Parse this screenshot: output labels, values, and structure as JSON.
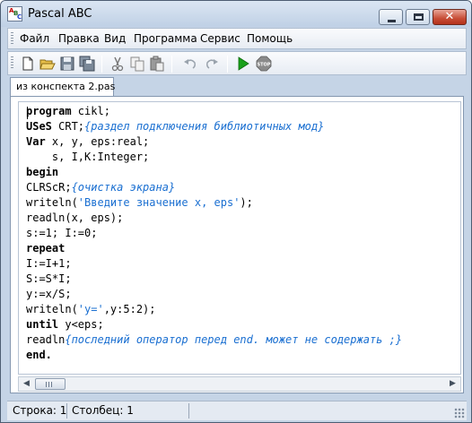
{
  "window": {
    "title": "Pascal ABC",
    "close_label": "✕"
  },
  "menu": {
    "items": [
      "Файл",
      "Правка",
      "Вид",
      "Программа",
      "Сервис",
      "Помощь"
    ]
  },
  "toolbar": {
    "buttons": [
      "new-file-icon",
      "open-folder-icon",
      "save-icon",
      "save-all-icon",
      "cut-icon",
      "copy-icon",
      "paste-icon",
      "undo-icon",
      "redo-icon",
      "run-icon",
      "stop-icon"
    ],
    "stop_label": "STOP",
    "colors": {
      "run": "#1aa01a",
      "stop": "#8a8a8a"
    }
  },
  "tabs": [
    {
      "label": "из конспекта 2.pas",
      "active": true
    }
  ],
  "editor": {
    "lines": [
      [
        {
          "t": "program",
          "k": "kw"
        },
        {
          "t": " cikl;",
          "k": ""
        }
      ],
      [
        {
          "t": "USeS",
          "k": "kw"
        },
        {
          "t": " CRT;",
          "k": ""
        },
        {
          "t": "{раздел подключения библиотичных мод}",
          "k": "cm"
        }
      ],
      [
        {
          "t": "Var",
          "k": "kw"
        },
        {
          "t": " x, y, eps:real;",
          "k": ""
        }
      ],
      [
        {
          "t": "    s, I,K:Integer;",
          "k": ""
        }
      ],
      [
        {
          "t": "begin",
          "k": "kw"
        }
      ],
      [
        {
          "t": "CLRScR;",
          "k": ""
        },
        {
          "t": "{очистка экрана}",
          "k": "cm"
        }
      ],
      [
        {
          "t": "writeln(",
          "k": ""
        },
        {
          "t": "'Введите значение x, eps'",
          "k": "str"
        },
        {
          "t": ");",
          "k": ""
        }
      ],
      [
        {
          "t": "readln(x, eps);",
          "k": ""
        }
      ],
      [
        {
          "t": "s:=1; I:=0;",
          "k": ""
        }
      ],
      [
        {
          "t": "repeat",
          "k": "kw"
        }
      ],
      [
        {
          "t": "I:=I+1;",
          "k": ""
        }
      ],
      [
        {
          "t": "S:=S*I;",
          "k": ""
        }
      ],
      [
        {
          "t": "y:=x/S;",
          "k": ""
        }
      ],
      [
        {
          "t": "writeln(",
          "k": ""
        },
        {
          "t": "'y='",
          "k": "str"
        },
        {
          "t": ",y:5:2);",
          "k": ""
        }
      ],
      [
        {
          "t": "until",
          "k": "kw"
        },
        {
          "t": " y<eps;",
          "k": ""
        }
      ],
      [
        {
          "t": "readln",
          "k": ""
        },
        {
          "t": "{последний оператор перед end. может не содержать ;}",
          "k": "cm"
        }
      ],
      [
        {
          "t": "end.",
          "k": "kw"
        }
      ]
    ],
    "colors": {
      "comment": "#1a6fd1",
      "string": "#1a6fd1"
    }
  },
  "scrollbar": {
    "left_arrow": "◀",
    "right_arrow": "▶"
  },
  "status": {
    "row": "Строка: 1",
    "column": "Столбец: 1"
  }
}
